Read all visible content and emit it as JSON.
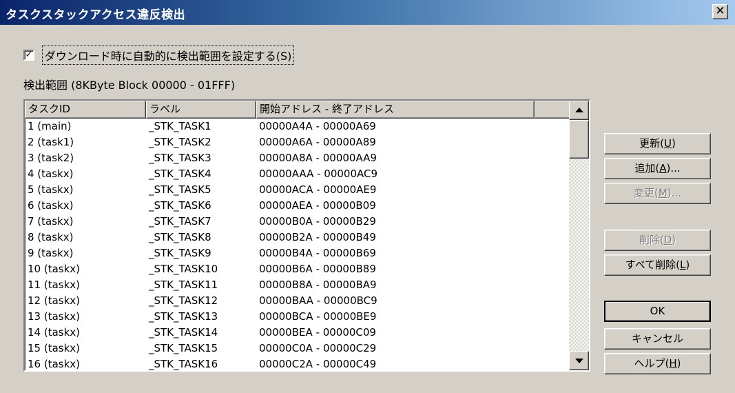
{
  "window": {
    "title": "タスクスタックアクセス違反検出",
    "close_glyph": "✕"
  },
  "auto_range": {
    "checked": true,
    "check_glyph": "✓",
    "label": "ダウンロード時に自動的に検出範囲を設定する(S)"
  },
  "range_label": "検出範囲 (8KByte Block  00000 - 01FFF)",
  "table": {
    "columns": [
      "タスクID",
      "ラベル",
      "開始アドレス - 終了アドレス"
    ],
    "rows": [
      {
        "id": "1 (main)",
        "label": "_STK_TASK1",
        "range": "00000A4A - 00000A69"
      },
      {
        "id": "2 (task1)",
        "label": "_STK_TASK2",
        "range": "00000A6A - 00000A89"
      },
      {
        "id": "3 (task2)",
        "label": "_STK_TASK3",
        "range": "00000A8A - 00000AA9"
      },
      {
        "id": "4 (taskx)",
        "label": "_STK_TASK4",
        "range": "00000AAA - 00000AC9"
      },
      {
        "id": "5 (taskx)",
        "label": "_STK_TASK5",
        "range": "00000ACA - 00000AE9"
      },
      {
        "id": "6 (taskx)",
        "label": "_STK_TASK6",
        "range": "00000AEA - 00000B09"
      },
      {
        "id": "7 (taskx)",
        "label": "_STK_TASK7",
        "range": "00000B0A - 00000B29"
      },
      {
        "id": "8 (taskx)",
        "label": "_STK_TASK8",
        "range": "00000B2A - 00000B49"
      },
      {
        "id": "9 (taskx)",
        "label": "_STK_TASK9",
        "range": "00000B4A - 00000B69"
      },
      {
        "id": "10 (taskx)",
        "label": "_STK_TASK10",
        "range": "00000B6A - 00000B89"
      },
      {
        "id": "11 (taskx)",
        "label": "_STK_TASK11",
        "range": "00000B8A - 00000BA9"
      },
      {
        "id": "12 (taskx)",
        "label": "_STK_TASK12",
        "range": "00000BAA - 00000BC9"
      },
      {
        "id": "13 (taskx)",
        "label": "_STK_TASK13",
        "range": "00000BCA - 00000BE9"
      },
      {
        "id": "14 (taskx)",
        "label": "_STK_TASK14",
        "range": "00000BEA - 00000C09"
      },
      {
        "id": "15 (taskx)",
        "label": "_STK_TASK15",
        "range": "00000C0A - 00000C29"
      },
      {
        "id": "16 (taskx)",
        "label": "_STK_TASK16",
        "range": "00000C2A - 00000C49"
      }
    ]
  },
  "buttons": {
    "update": {
      "text": "更新(",
      "key": "U",
      "suffix": ")"
    },
    "add": {
      "text": "追加(",
      "key": "A",
      "suffix": ")..."
    },
    "modify": {
      "text": "変更(",
      "key": "M",
      "suffix": ")..."
    },
    "delete": {
      "text": "削除(",
      "key": "D",
      "suffix": ")"
    },
    "delete_all": {
      "text": "すべて削除(",
      "key": "L",
      "suffix": ")"
    },
    "ok": {
      "text": "OK"
    },
    "cancel": {
      "text": "キャンセル"
    },
    "help": {
      "text": "ヘルプ(",
      "key": "H",
      "suffix": ")"
    }
  }
}
